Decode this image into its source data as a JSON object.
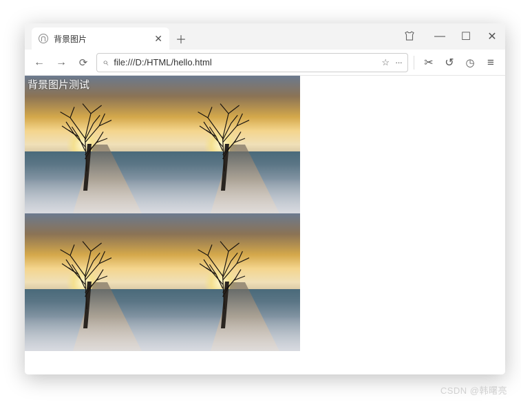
{
  "window": {
    "minimize": "—",
    "maximize": "☐",
    "close": "✕"
  },
  "tab": {
    "title": "背景图片",
    "close": "✕",
    "new": "＋"
  },
  "toolbar": {
    "back": "←",
    "forward": "→",
    "reload": "⟳",
    "search_icon": "⌕",
    "url": "file:///D:/HTML/hello.html",
    "star": "☆",
    "more": "···",
    "cut": "✂",
    "undo": "↺",
    "clock": "◷",
    "menu": "≡"
  },
  "page": {
    "overlay_text": "背景图片测试"
  },
  "watermark": "CSDN @韩曙亮"
}
